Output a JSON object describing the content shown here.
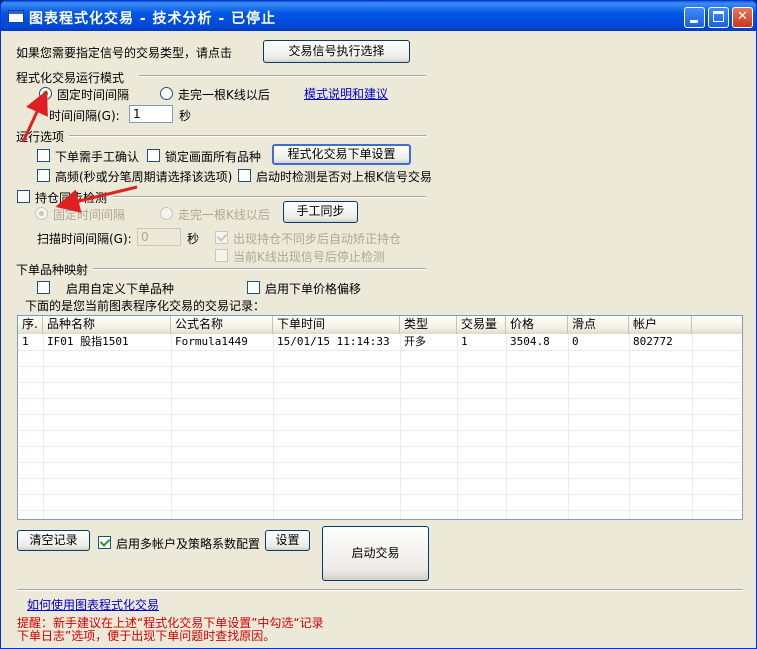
{
  "window": {
    "title": "图表程式化交易 - 技术分析 - 已停止",
    "min_glyph": "",
    "max_glyph": "",
    "close_glyph": "✕"
  },
  "signal": {
    "prompt": "如果您需要指定信号的交易类型，请点击",
    "button": "交易信号执行选择"
  },
  "mode": {
    "group_title": "程式化交易运行模式",
    "fixed_interval": "固定时间间隔",
    "after_bar": "走完一根K线以后",
    "help_link": "模式说明和建议",
    "interval_label": "时间间隔(G):",
    "interval_value": "1",
    "interval_unit": "秒"
  },
  "run_options": {
    "group_title": "运行选项",
    "manual_confirm": "下单需手工确认",
    "lock_all": "锁定画面所有品种",
    "order_settings_button": "程式化交易下单设置",
    "high_freq": "高频(秒或分笔周期请选择该选项)",
    "check_last_signal": "启动时检测是否对上根K信号交易"
  },
  "sync": {
    "checkbox": "持仓同步检测",
    "fixed_interval": "固定时间间隔",
    "after_bar": "走完一根K线以后",
    "manual_sync_button": "手工同步",
    "scan_label": "扫描时间间隔(G):",
    "scan_value": "0",
    "scan_unit": "秒",
    "auto_correct": "出现持仓不同步后自动矫正持仓",
    "stop_check": "当前K线出现信号后停止检测"
  },
  "mapping": {
    "group_title": "下单品种映射",
    "custom_symbol": "启用自定义下单品种",
    "price_offset": "启用下单价格偏移",
    "records_title": "下面的是您当前图表程序化交易的交易记录："
  },
  "table": {
    "headers": [
      "序.",
      "品种名称",
      "公式名称",
      "下单时间",
      "类型",
      "交易量",
      "价格",
      "滑点",
      "帐户"
    ],
    "rows": [
      [
        "1",
        "IF01 股指1501",
        "Formula1449",
        "15/01/15 11:14:33",
        "开多",
        "1",
        "3504.8",
        "0",
        "802772"
      ]
    ]
  },
  "footer": {
    "clear_button": "清空记录",
    "multi_account": "启用多帐户及策略系数配置",
    "settings_button": "设置",
    "start_button": "启动交易",
    "howto_link": "如何使用图表程式化交易",
    "hint_line1": "提醒：新手建议在上述“程式化交易下单设置”中勾选“记录",
    "hint_line2": "下单日志”选项，便于出现下单问题时查找原因。"
  },
  "colors": {
    "title_bar": "#0058e6",
    "dialog_bg": "#ece9d8",
    "hint_red": "#d40000",
    "link_blue": "#0000cc",
    "arrow_red": "#e02020"
  }
}
